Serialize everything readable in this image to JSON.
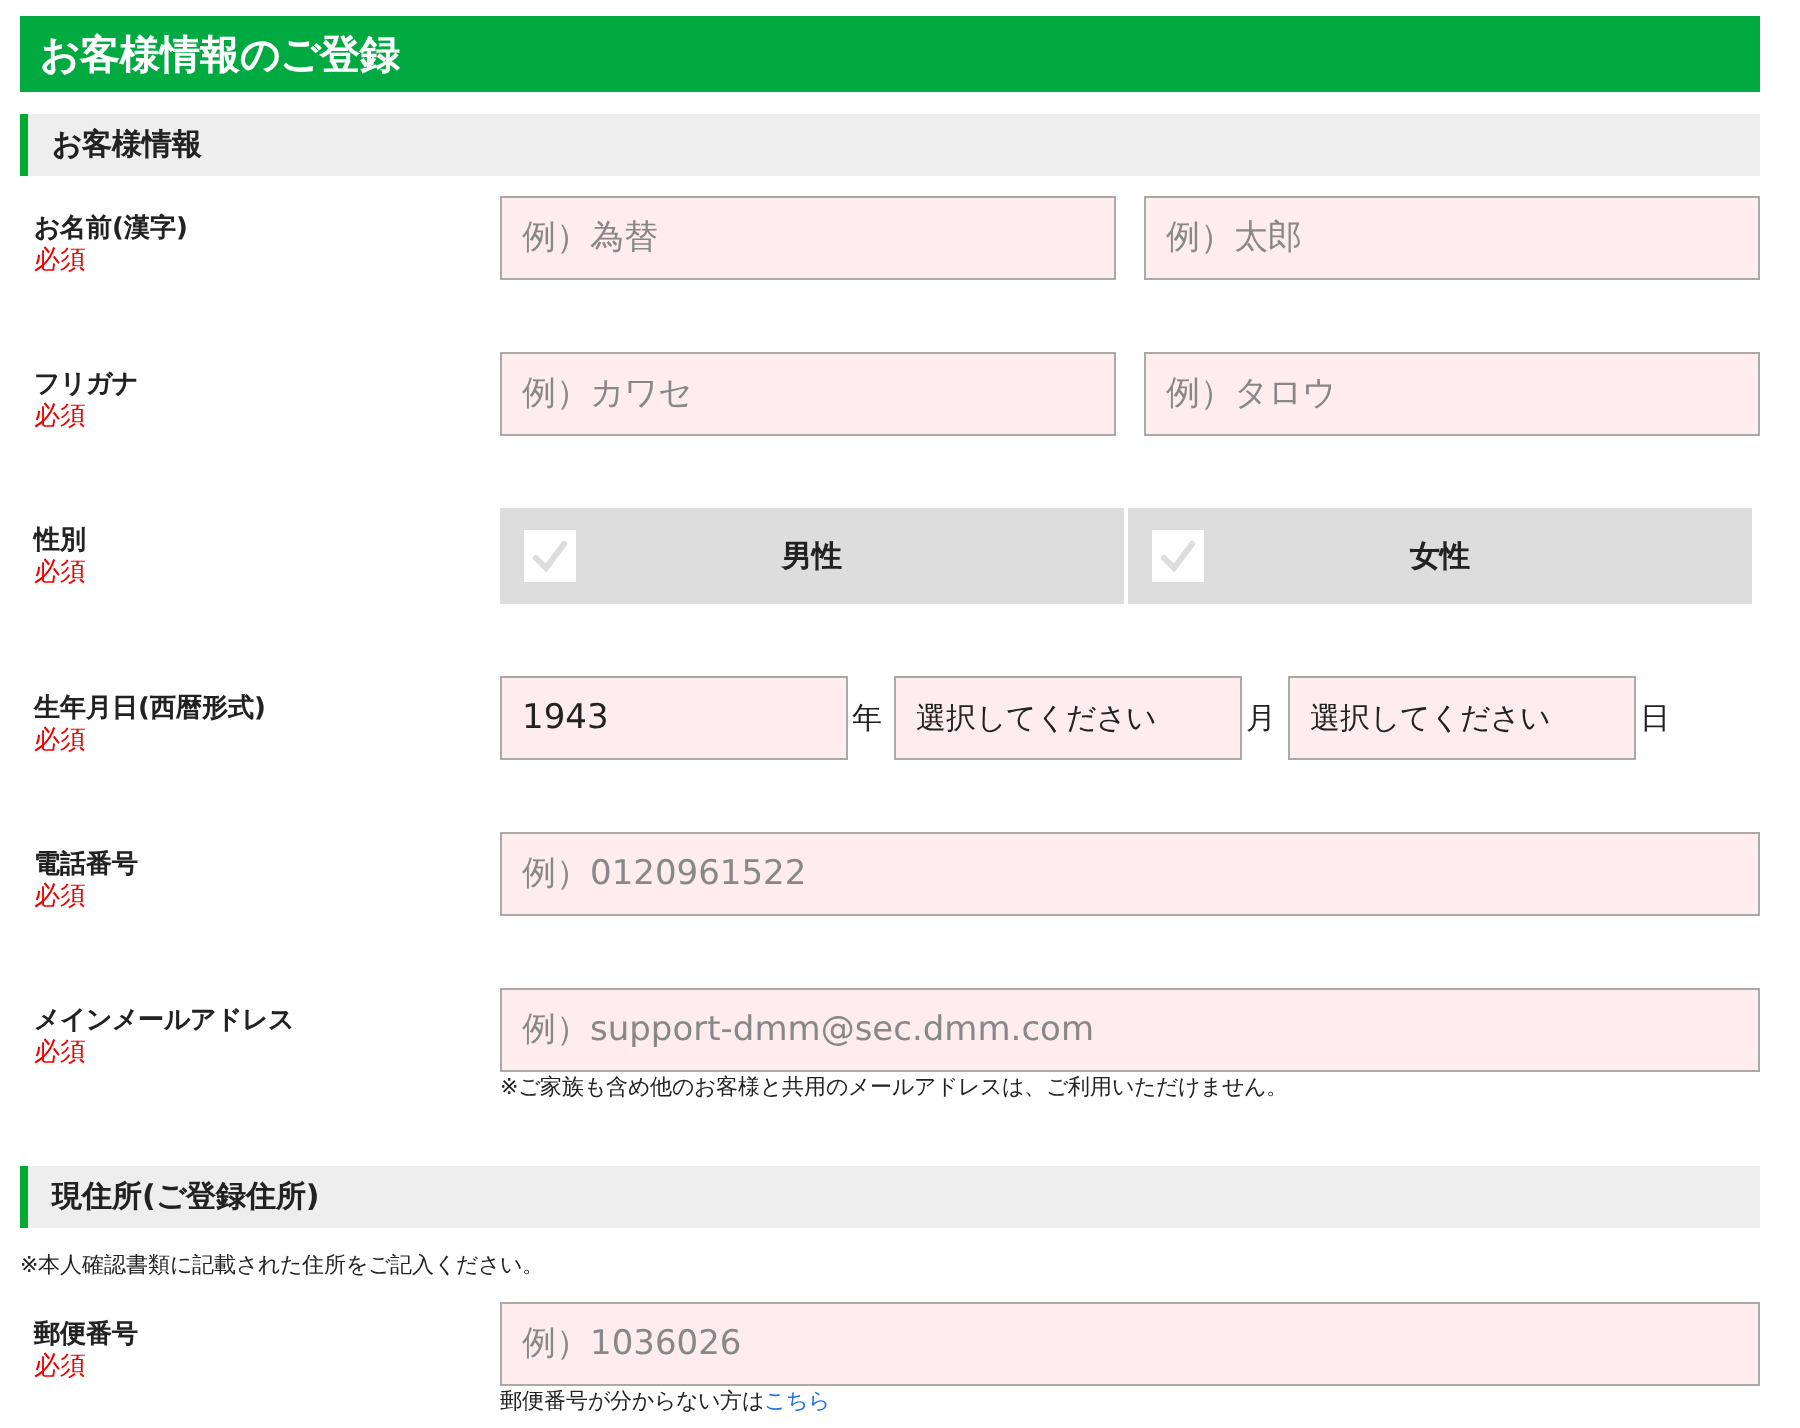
{
  "title": "お客様情報のご登録",
  "sections": [
    {
      "heading": "お客様情報",
      "rows": [
        {
          "kind": "text",
          "label": "お名前(漢字)",
          "required": "必須",
          "fields": [
            {
              "placeholder": "例）為替"
            },
            {
              "placeholder": "例）太郎"
            }
          ]
        },
        {
          "kind": "text",
          "label": "フリガナ",
          "required": "必須",
          "fields": [
            {
              "placeholder": "例）カワセ"
            },
            {
              "placeholder": "例）タロウ"
            }
          ]
        },
        {
          "kind": "choice",
          "label": "性別",
          "required": "必須",
          "options": [
            {
              "label": "男性",
              "checked": false
            },
            {
              "label": "女性",
              "checked": false
            }
          ]
        },
        {
          "kind": "date",
          "label": "生年月日(西暦形式)",
          "required": "必須",
          "parts": [
            {
              "kind": "input",
              "value": "1943",
              "unit": "年"
            },
            {
              "kind": "select",
              "value": "選択してください",
              "unit": "月"
            },
            {
              "kind": "select",
              "value": "選択してください",
              "unit": "日"
            }
          ]
        },
        {
          "kind": "text",
          "label": "電話番号",
          "required": "必須",
          "fields": [
            {
              "placeholder": "例）0120961522"
            }
          ]
        },
        {
          "kind": "text",
          "label": "メインメールアドレス",
          "required": "必須",
          "fields": [
            {
              "placeholder": "例）support-dmm@sec.dmm.com"
            }
          ],
          "note": {
            "text": "※ご家族も含め他のお客様と共用のメールアドレスは、ご利用いただけません。"
          }
        }
      ]
    },
    {
      "heading": "現住所(ご登録住所)",
      "note": "※本人確認書類に記載された住所をご記入ください。",
      "rows": [
        {
          "kind": "text",
          "label": "郵便番号",
          "required": "必須",
          "fields": [
            {
              "placeholder": "例）1036026"
            }
          ],
          "note": {
            "text": "郵便番号が分からない方は",
            "link": "こちら"
          }
        }
      ]
    }
  ]
}
